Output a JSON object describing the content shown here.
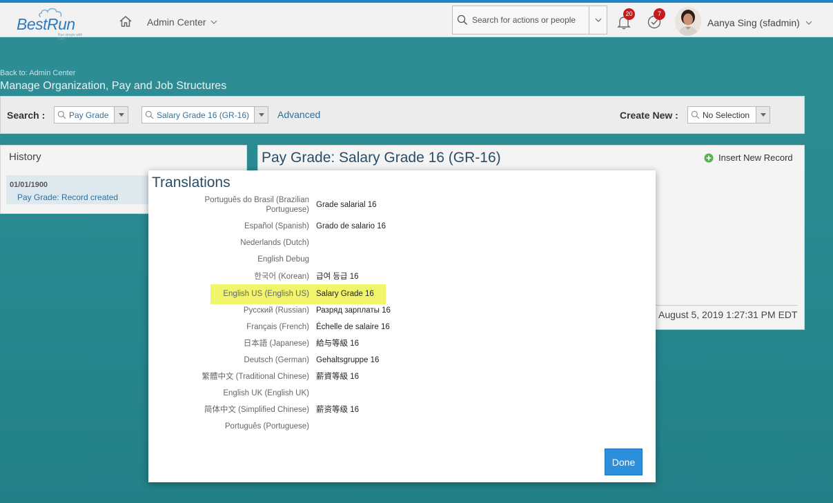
{
  "shell": {
    "logo_text": "BestRun",
    "logo_tagline": "Run simple with SAP",
    "nav_menu": "Admin Center",
    "search_placeholder": "Search for actions or people",
    "notifications_count": "20",
    "todo_count": "7",
    "user_name": "Aanya Sing (sfadmin)"
  },
  "page": {
    "back_link": "Back to: Admin Center",
    "title": "Manage Organization, Pay and Job Structures"
  },
  "search_panel": {
    "search_label": "Search :",
    "type_value": "Pay Grade",
    "item_value": "Salary Grade 16 (GR-16)",
    "advanced_label": "Advanced",
    "create_new_label": "Create New :",
    "create_new_value": "No Selection"
  },
  "history": {
    "title": "History",
    "items": [
      {
        "date": "01/01/1900",
        "desc": "Pay Grade: Record created"
      }
    ]
  },
  "detail": {
    "title": "Pay Grade: Salary Grade 16 (GR-16)",
    "insert_label": "Insert New Record",
    "timestamp": "August 5, 2019 1:27:31 PM EDT"
  },
  "dialog": {
    "title": "Translations",
    "done_label": "Done",
    "highlight_color": "#f1f56a",
    "rows": [
      {
        "label": "Português do Brasil (Brazilian Portuguese)",
        "value": "Grade salarial 16"
      },
      {
        "label": "Español (Spanish)",
        "value": "Grado de salario 16"
      },
      {
        "label": "Nederlands (Dutch)",
        "value": ""
      },
      {
        "label": "English Debug",
        "value": ""
      },
      {
        "label": "한국어 (Korean)",
        "value": "급여 등급 16"
      },
      {
        "label": "English US (English US)",
        "value": "Salary Grade 16"
      },
      {
        "label": "Русский (Russian)",
        "value": "Разряд зарплаты 16"
      },
      {
        "label": "Français (French)",
        "value": "Échelle de salaire 16"
      },
      {
        "label": "日本語 (Japanese)",
        "value": "給与等級 16"
      },
      {
        "label": "Deutsch (German)",
        "value": "Gehaltsgruppe 16"
      },
      {
        "label": "繁體中文 (Traditional Chinese)",
        "value": "薪資等級 16"
      },
      {
        "label": "English UK (English UK)",
        "value": ""
      },
      {
        "label": "简体中文 (Simplified Chinese)",
        "value": "薪资等级 16"
      },
      {
        "label": "Português (Portuguese)",
        "value": ""
      }
    ]
  }
}
